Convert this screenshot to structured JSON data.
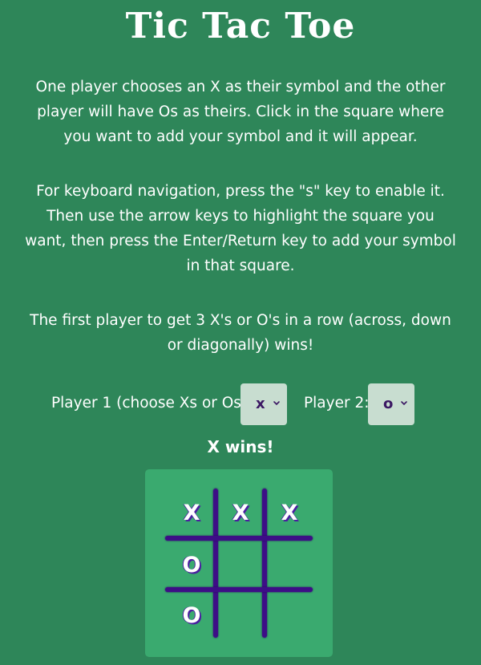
{
  "title": "Tic Tac Toe",
  "instructions": [
    "One player chooses an X as their symbol and the other player will have Os as theirs. Click in the square where you want to add your symbol and it will appear.",
    "For keyboard navigation, press the \"s\" key to enable it. Then use the arrow keys to highlight the square you want, then press the Enter/Return key to add your symbol in that square.",
    "The first player to get 3 X's or O's in a row (across, down or diagonally) wins!"
  ],
  "players": {
    "player1_label": "Player 1 (choose Xs or Os):",
    "player1_value": "x",
    "player2_label": "Player 2:",
    "player2_value": "o"
  },
  "status": "X wins!",
  "board": {
    "cells": [
      "X",
      "X",
      "X",
      "O",
      "",
      "",
      "O",
      "",
      ""
    ]
  },
  "colors": {
    "background": "#2e8659",
    "board": "#3aaa6f",
    "grid_lines": "#3d0e86",
    "select_bg": "#c8ddd0",
    "select_text": "#3b1763"
  },
  "icons": {
    "select_arrow": "chevron-down-icon"
  }
}
